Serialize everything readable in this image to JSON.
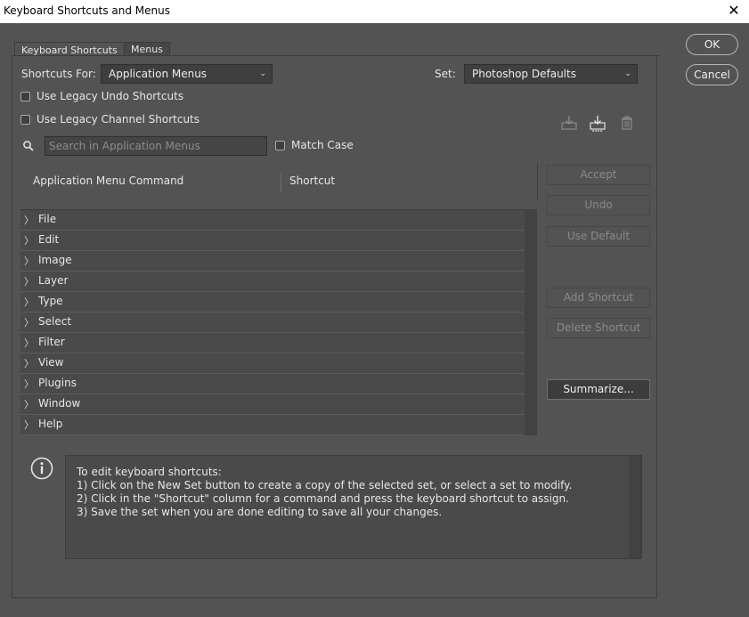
{
  "window": {
    "title": "Keyboard Shortcuts and Menus"
  },
  "tabs": [
    "Keyboard Shortcuts",
    "Menus"
  ],
  "shortcuts_for": {
    "label": "Shortcuts For:",
    "value": "Application Menus"
  },
  "set": {
    "label": "Set:",
    "value": "Photoshop Defaults"
  },
  "options": {
    "legacy_undo": "Use Legacy Undo Shortcuts",
    "legacy_channel": "Use Legacy Channel Shortcuts",
    "match_case": "Match Case"
  },
  "search": {
    "placeholder": "Search in Application Menus"
  },
  "columns": {
    "command": "Application Menu Command",
    "shortcut": "Shortcut"
  },
  "menus": [
    "File",
    "Edit",
    "Image",
    "Layer",
    "Type",
    "Select",
    "Filter",
    "View",
    "Plugins",
    "Window",
    "Help"
  ],
  "buttons": {
    "ok": "OK",
    "cancel": "Cancel",
    "accept": "Accept",
    "undo": "Undo",
    "use_default": "Use Default",
    "add_shortcut": "Add Shortcut",
    "delete_shortcut": "Delete Shortcut",
    "summarize": "Summarize..."
  },
  "info": {
    "lines": [
      "To edit keyboard shortcuts:",
      "1) Click on the New Set button to create a copy of the selected set, or select a set to modify.",
      "2) Click in the \"Shortcut\" column for a command and press the keyboard shortcut to assign.",
      "3) Save the set when you are done editing to save all your changes."
    ]
  },
  "icons": {
    "close": "close-icon",
    "search": "search-icon",
    "save_set": "save-set-icon",
    "save_as_set": "save-as-set-icon",
    "delete_set": "trash-icon",
    "info": "info-icon",
    "chevron": "chevron-right-icon"
  }
}
